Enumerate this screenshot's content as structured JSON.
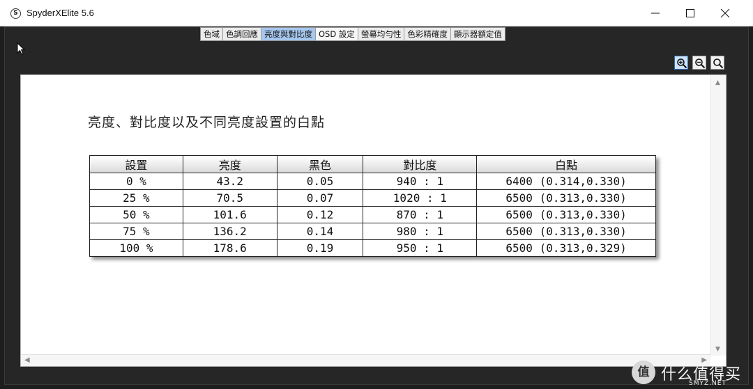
{
  "window": {
    "title": "SpyderXElite 5.6",
    "app_icon": "S"
  },
  "tabs": [
    {
      "label": "色域",
      "active": false
    },
    {
      "label": "色調回應",
      "active": false
    },
    {
      "label": "亮度與對比度",
      "active": true
    },
    {
      "label": "OSD 設定",
      "active": false
    },
    {
      "label": "螢幕均勻性",
      "active": false
    },
    {
      "label": "色彩精確度",
      "active": false
    },
    {
      "label": "顯示器額定值",
      "active": false
    }
  ],
  "zoom_buttons": [
    "zoom-in-icon",
    "zoom-out-icon",
    "zoom-fit-icon"
  ],
  "report": {
    "title": "亮度、對比度以及不同亮度設置的白點",
    "table": {
      "headers": [
        "設置",
        "亮度",
        "黑色",
        "對比度",
        "白點"
      ],
      "rows": [
        [
          "0 %",
          "43.2",
          "0.05",
          "940 : 1",
          "6400 (0.314,0.330)"
        ],
        [
          "25 %",
          "70.5",
          "0.07",
          "1020 : 1",
          "6500 (0.313,0.330)"
        ],
        [
          "50 %",
          "101.6",
          "0.12",
          "870 : 1",
          "6500 (0.313,0.330)"
        ],
        [
          "75 %",
          "136.2",
          "0.14",
          "980 : 1",
          "6500 (0.313,0.330)"
        ],
        [
          "100 %",
          "178.6",
          "0.19",
          "950 : 1",
          "6500 (0.313,0.329)"
        ]
      ]
    }
  },
  "watermark": {
    "badge": "值",
    "text": "什么值得买",
    "sub": "SMYZ.NET"
  },
  "colors": {
    "active_tab": "#a6c8ef",
    "app_background": "#262626",
    "viewer_background": "#ffffff"
  }
}
